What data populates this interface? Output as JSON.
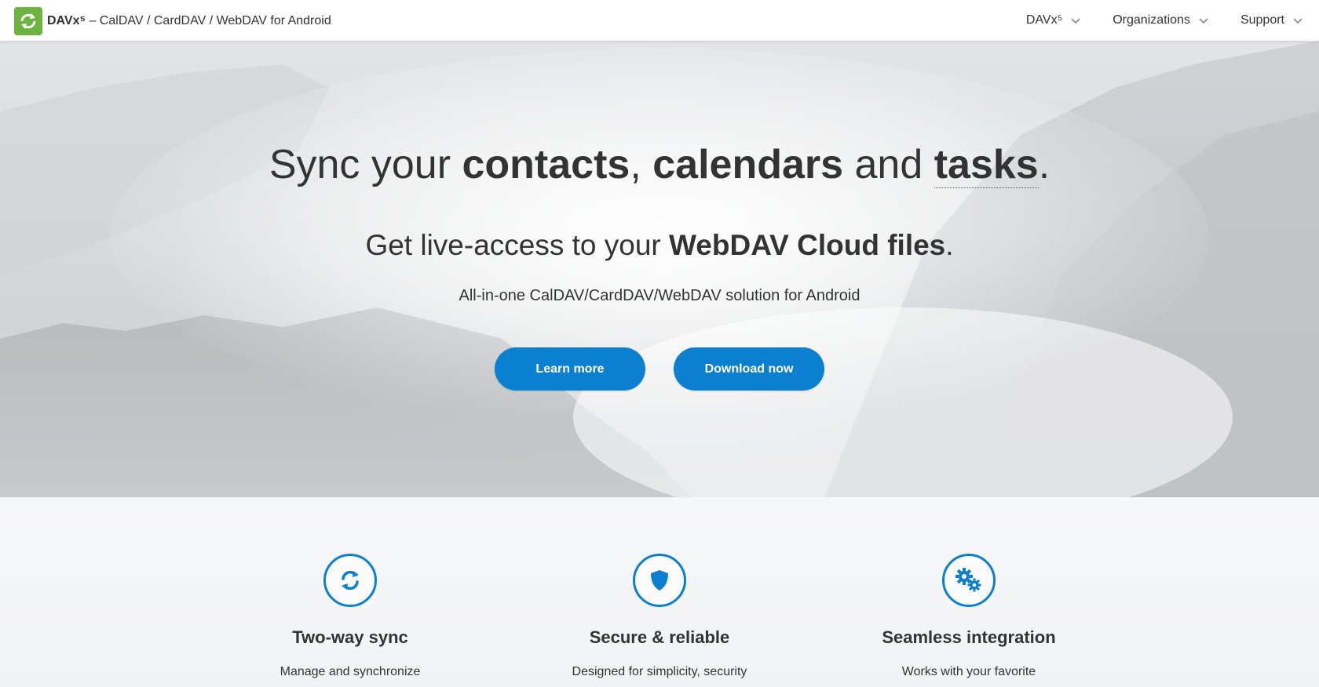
{
  "header": {
    "brand_name": "DAVx⁵",
    "brand_tagline": " – CalDAV / CardDAV / WebDAV for Android",
    "nav": [
      {
        "label": "DAVx⁵"
      },
      {
        "label": "Organizations"
      },
      {
        "label": "Support"
      }
    ]
  },
  "hero": {
    "title_1": "Sync your ",
    "title_contacts": "contacts",
    "title_comma": ", ",
    "title_calendars": "calendars",
    "title_and": " and ",
    "title_tasks": "tasks",
    "title_end": ".",
    "sub_1": "Get live-access to your ",
    "sub_bold": "WebDAV Cloud files",
    "sub_end": ".",
    "tagline": "All-in-one CalDAV/CardDAV/WebDAV solution for Android",
    "learn_more": "Learn more",
    "download_now": "Download now"
  },
  "features": [
    {
      "icon": "sync-icon",
      "title": "Two-way sync",
      "desc": "Manage and synchronize"
    },
    {
      "icon": "shield-icon",
      "title": "Secure & reliable",
      "desc": "Designed for simplicity, security"
    },
    {
      "icon": "gears-icon",
      "title": "Seamless integration",
      "desc": "Works with your favorite"
    }
  ],
  "colors": {
    "accent": "#0b7fd0",
    "logo": "#6db33f",
    "text": "#333333"
  }
}
